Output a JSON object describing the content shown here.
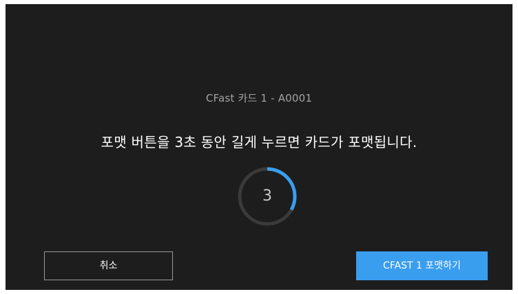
{
  "dialog": {
    "card_label": "CFast 카드 1 - A0001",
    "message": "포맷 버튼을 3초 동안 길게 누르면 카드가 포맷됩니다."
  },
  "countdown": {
    "value": "3",
    "progress_fraction": 0.33,
    "track_color": "#3a3a3a",
    "progress_color": "#3a9eef"
  },
  "buttons": {
    "cancel_label": "취소",
    "format_label": "CFAST 1 포맷하기"
  },
  "colors": {
    "background": "#1d1d1d",
    "accent": "#3a9eef"
  }
}
